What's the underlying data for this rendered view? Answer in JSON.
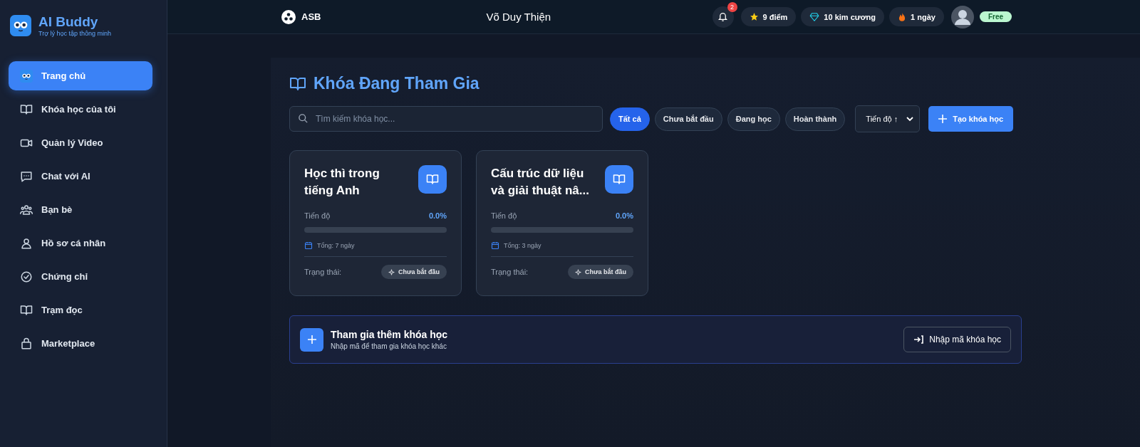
{
  "brand": {
    "name": "AI Buddy",
    "tagline": "Trợ lý học tập thông minh"
  },
  "sidebar": {
    "items": [
      {
        "label": "Trang chủ",
        "selected": true
      },
      {
        "label": "Khóa học của tôi",
        "selected": false
      },
      {
        "label": "Quản lý Video",
        "selected": false
      },
      {
        "label": "Chat với AI",
        "selected": false
      },
      {
        "label": "Bạn bè",
        "selected": false
      },
      {
        "label": "Hồ sơ cá nhân",
        "selected": false
      },
      {
        "label": "Chứng chỉ",
        "selected": false
      },
      {
        "label": "Trạm đọc",
        "selected": false
      },
      {
        "label": "Marketplace",
        "selected": false
      }
    ]
  },
  "header": {
    "org": "ASB",
    "user_name": "Võ Duy Thiện",
    "notifications": "2",
    "stats": [
      {
        "kind": "star",
        "label": "9 điểm"
      },
      {
        "kind": "diamond",
        "label": "10 kim cương"
      },
      {
        "kind": "flame",
        "label": "1 ngày"
      }
    ],
    "plan": "Free"
  },
  "page": {
    "title": "Khóa Đang Tham Gia",
    "search": {
      "placeholder": "Tìm kiếm khóa học..."
    },
    "filters": [
      {
        "label": "Tất cả",
        "selected": true
      },
      {
        "label": "Chưa bắt đầu",
        "selected": false
      },
      {
        "label": "Đang học",
        "selected": false
      },
      {
        "label": "Hoàn thành",
        "selected": false
      }
    ],
    "sort": "Tiến độ ↑",
    "create_button": "Tạo khóa học"
  },
  "courses": [
    {
      "title": "Học thì trong tiếng Anh",
      "progress_label": "Tiến độ",
      "progress": "0.0%",
      "level": 0,
      "duration": "Tổng: 7 ngày",
      "status_label": "Trạng thái:",
      "status": "Chưa bắt đầu"
    },
    {
      "title": "Cấu trúc dữ liệu và giải thuật nâ...",
      "progress_label": "Tiến độ",
      "progress": "0.0%",
      "level": 0,
      "duration": "Tổng: 3 ngày",
      "status_label": "Trạng thái:",
      "status": "Chưa bắt đầu"
    }
  ],
  "join": {
    "title": "Tham gia thêm khóa học",
    "subtitle": "Nhập mã để tham gia khóa học khác",
    "button": "Nhập mã khóa học"
  }
}
